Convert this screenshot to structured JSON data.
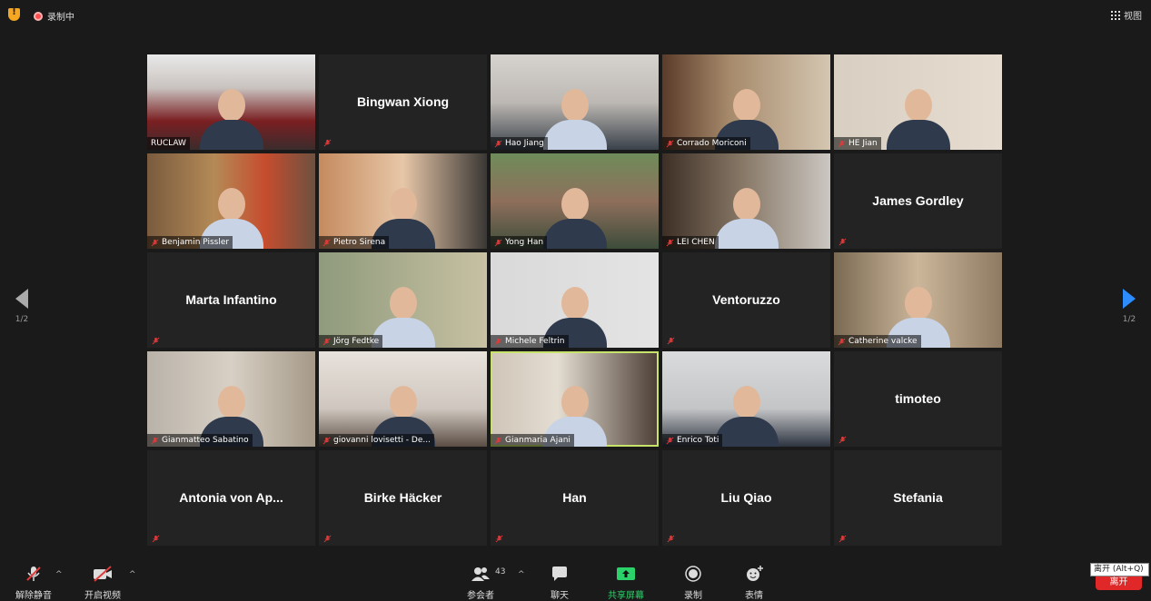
{
  "topbar": {
    "recording_label": "录制中",
    "view_label": "视图"
  },
  "pager": {
    "left": "1/2",
    "right": "1/2"
  },
  "tiles": [
    {
      "name": "RUCLAW",
      "kind": "video",
      "style": "v1"
    },
    {
      "name": "Bingwan Xiong",
      "kind": "name"
    },
    {
      "name": "Hao Jiang",
      "kind": "video",
      "style": "v2"
    },
    {
      "name": "Corrado Moriconi",
      "kind": "video",
      "style": "v3"
    },
    {
      "name": "HE Jian",
      "kind": "video",
      "style": "v4"
    },
    {
      "name": "Benjamin Pissler",
      "kind": "video",
      "style": "v5"
    },
    {
      "name": "Pietro Sirena",
      "kind": "video",
      "style": "v6"
    },
    {
      "name": "Yong Han",
      "kind": "video",
      "style": "v7"
    },
    {
      "name": "LEI CHEN",
      "kind": "video",
      "style": "v8"
    },
    {
      "name": "James Gordley",
      "kind": "name"
    },
    {
      "name": "Marta Infantino",
      "kind": "name"
    },
    {
      "name": "Jörg Fedtke",
      "kind": "video",
      "style": "v10"
    },
    {
      "name": "Michele Feltrin",
      "kind": "video",
      "style": "v11"
    },
    {
      "name": "Ventoruzzo",
      "kind": "name"
    },
    {
      "name": "Catherine valcke",
      "kind": "video",
      "style": "v12"
    },
    {
      "name": "Gianmatteo Sabatino",
      "kind": "video",
      "style": "v13"
    },
    {
      "name": "giovanni lovisetti - De...",
      "kind": "video",
      "style": "v14"
    },
    {
      "name": "Gianmaria Ajani",
      "kind": "video",
      "style": "v15",
      "active": true
    },
    {
      "name": "Enrico Toti",
      "kind": "video",
      "style": "v16"
    },
    {
      "name": "timoteo",
      "kind": "name"
    },
    {
      "name": "Antonia von Ap...",
      "kind": "name"
    },
    {
      "name": "Birke Häcker",
      "kind": "name"
    },
    {
      "name": "Han",
      "kind": "name"
    },
    {
      "name": "Liu Qiao",
      "kind": "name"
    },
    {
      "name": "Stefania",
      "kind": "name"
    }
  ],
  "toolbar": {
    "unmute_label": "解除静音",
    "start_video_label": "开启视频",
    "participants_label": "参会者",
    "participants_count": "43",
    "chat_label": "聊天",
    "share_label": "共享屏幕",
    "record_label": "录制",
    "reactions_label": "表情",
    "leave_label": "离开",
    "leave_tooltip": "离开 (Alt+Q)"
  },
  "colors": {
    "background": "#1a1a1a",
    "tile": "#232323",
    "muted_red": "#e03a3a",
    "share_green": "#2bd26a",
    "next_arrow": "#2d8cff",
    "leave_red": "#e02828",
    "active_speaker": "#c8e36a"
  }
}
